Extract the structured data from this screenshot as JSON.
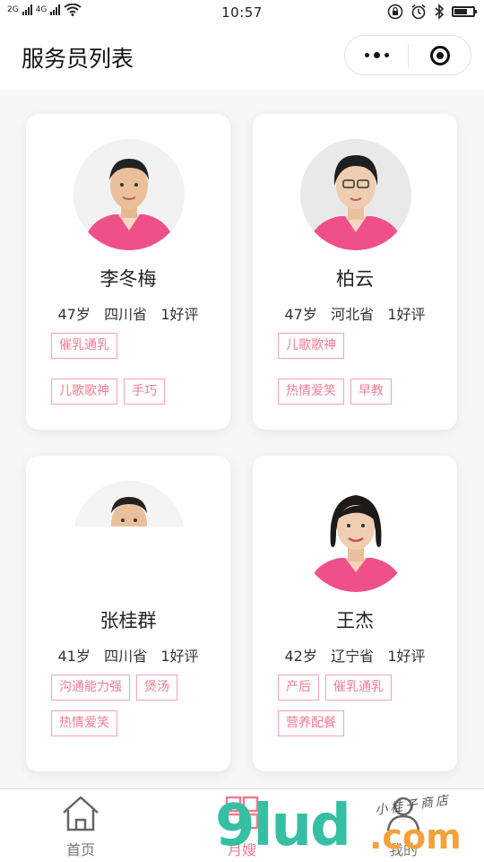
{
  "status_bar": {
    "network_1": "2G",
    "network_2": "4G",
    "time": "10:57",
    "icons": [
      "signal-icon",
      "wifi-icon",
      "lock-rotation-icon",
      "alarm-icon",
      "bluetooth-icon",
      "battery-icon"
    ],
    "battery_level": 0.8
  },
  "nav": {
    "title": "服务员列表",
    "menu_icon": "more-dots-icon",
    "close_icon": "target-icon"
  },
  "theme": {
    "accent": "#f07c91",
    "tag_border": "#f3a3b2",
    "uniform_pink": "#f0508a",
    "watermark_green": "#35bfa3",
    "watermark_orange": "#f4a13a"
  },
  "workers": [
    {
      "name": "李冬梅",
      "meta": "47岁   四川省   1好评",
      "tags": [
        "催乳通乳",
        "儿歌歌神",
        "手巧"
      ],
      "avatar_loaded": true
    },
    {
      "name": "柏云",
      "meta": "47岁   河北省   1好评",
      "tags": [
        "儿歌歌神",
        "热情爱笑",
        "早教"
      ],
      "avatar_loaded": true
    },
    {
      "name": "张桂群",
      "meta": "41岁   四川省   1好评",
      "tags": [
        "沟通能力强",
        "煲汤",
        "热情爱笑"
      ],
      "avatar_loaded": "partial"
    },
    {
      "name": "王杰",
      "meta": "42岁   辽宁省   1好评",
      "tags": [
        "产后",
        "催乳通乳",
        "营养配餐"
      ],
      "avatar_loaded": true
    }
  ],
  "tabbar": {
    "items": [
      {
        "label": "首页",
        "icon": "home-icon"
      },
      {
        "label": "月嫂",
        "icon": "grid-icon"
      },
      {
        "label": "我的",
        "icon": "user-icon"
      }
    ]
  },
  "watermark": {
    "brand": "9lud",
    "suffix": ".com",
    "script": "小桂子商店"
  }
}
